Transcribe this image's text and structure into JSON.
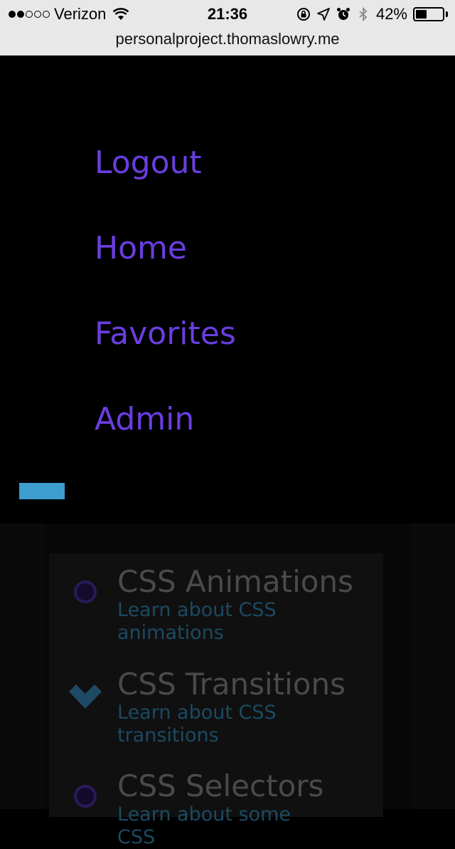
{
  "status_bar": {
    "carrier": "Verizon",
    "time": "21:36",
    "battery": "42%",
    "battery_level": 0.42,
    "signal_filled": 2,
    "signal_total": 5,
    "icons": [
      "wifi-icon",
      "orientation-lock-icon",
      "location-arrow-icon",
      "alarm-icon",
      "bluetooth-icon",
      "battery-icon"
    ]
  },
  "browser": {
    "url": "personalproject.thomaslowry.me"
  },
  "nav": {
    "items": [
      {
        "label": "Logout"
      },
      {
        "label": "Home"
      },
      {
        "label": "Favorites"
      },
      {
        "label": "Admin"
      }
    ],
    "link_color": "#6a3ee0",
    "toggle_color": "#3e9ecf"
  },
  "content": {
    "topics": [
      {
        "title": "CSS Animations",
        "description": "Learn about CSS animations",
        "marker": "circle-icon"
      },
      {
        "title": "CSS Transitions",
        "description": "Learn about CSS transitions",
        "marker": "heart-icon"
      },
      {
        "title": "CSS Selectors",
        "description": "Learn about some CSS",
        "marker": "circle-icon"
      }
    ]
  }
}
